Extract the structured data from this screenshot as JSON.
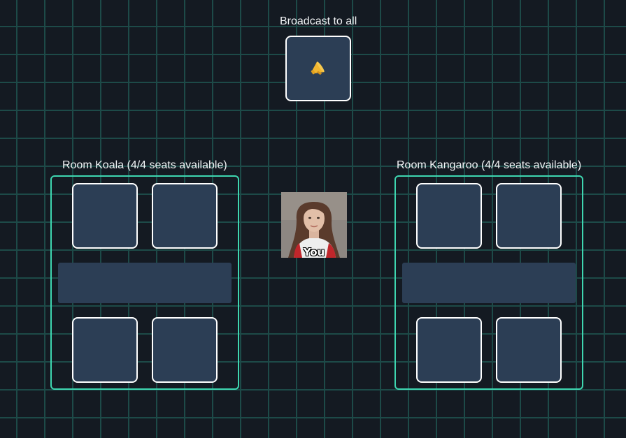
{
  "broadcast": {
    "label": "Broadcast to all",
    "icon": "megaphone-icon"
  },
  "rooms": [
    {
      "name": "Koala",
      "title": "Room Koala (4/4 seats available)",
      "seats_available": 4,
      "seats_total": 4
    },
    {
      "name": "Kangaroo",
      "title": "Room Kangaroo (4/4 seats available)",
      "seats_available": 4,
      "seats_total": 4
    }
  ],
  "self": {
    "label": "You"
  },
  "colors": {
    "background": "#141a22",
    "grid": "#1d4a48",
    "room_border": "#3ed6b0",
    "tile_fill": "#2c3e55",
    "tile_border": "#ffffff",
    "megaphone": "#f2b630"
  }
}
